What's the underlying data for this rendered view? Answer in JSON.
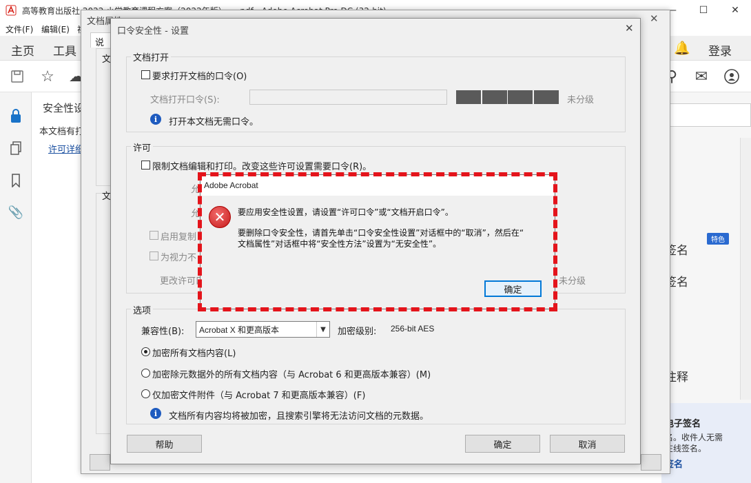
{
  "app": {
    "title": "高等教育出版社 2022 小学教育课程方案（2022年版）… .pdf - Adobe Acrobat Pro DC (32-bit)",
    "win_minimize": "—",
    "win_maximize": "☐",
    "win_close": "✕"
  },
  "menubar": [
    "文件(F)",
    "编辑(E)",
    "视"
  ],
  "navbar": {
    "home": "主页",
    "tools": "工具",
    "login": "登录"
  },
  "left_panel": {
    "title": "安全性设",
    "desc": "本文档有打",
    "link": "许可详细"
  },
  "right_panel": {
    "items": [
      "签名",
      "签名",
      "注释"
    ],
    "badge": "特色",
    "footer_title": "电子签名",
    "footer_line1": "名。收件人无需",
    "footer_line2": "在线签名。",
    "footer_link": "签名"
  },
  "doc_props": {
    "title": "文档属性",
    "tab": "说明",
    "group1": "文",
    "group2": "文"
  },
  "pw_dialog": {
    "title": "口令安全性 - 设置",
    "open_group": "文档打开",
    "require_open_pw": "要求打开文档的口令(O)",
    "open_pw_label": "文档打开口令(S):",
    "open_pw_value": "",
    "strength": "未分级",
    "open_info": "打开本文档无需口令。",
    "perm_group": "许可",
    "restrict_label": "限制文档编辑和打印。改变这些许可设置需要口令(R)。",
    "allow1": "允",
    "allow2": "允",
    "enable_copy": "启用复制",
    "vision": "为视力不",
    "change_perm": "更改许可口",
    "perm_strength": "未分级",
    "options_group": "选项",
    "compat_label": "兼容性(B):",
    "compat_value": "Acrobat X 和更高版本",
    "enc_level_label": "加密级别:",
    "enc_level_value": "256-bit AES",
    "radio1": "加密所有文档内容(L)",
    "radio2": "加密除元数据外的所有文档内容（与 Acrobat 6 和更高版本兼容）(M)",
    "radio3": "仅加密文件附件（与 Acrobat 7 和更高版本兼容）(F)",
    "options_info": "文档所有内容均将被加密，且搜索引擎将无法访问文档的元数据。",
    "help_btn": "帮助",
    "ok_btn": "确定",
    "cancel_btn": "取消"
  },
  "alert": {
    "title": "Adobe Acrobat",
    "line1": "要应用安全性设置，请设置“许可口令”或“文档开启口令”。",
    "line2": "要删除口令安全性，请首先单击“口令安全性设置”对话框中的“取消”，然后在“",
    "line3": "文档属性”对话框中将“安全性方法”设置为“无安全性”。",
    "ok_btn": "确定"
  },
  "colors": {
    "alert_dash": "#e4141b",
    "error_icon": "#c61b1b",
    "info_icon": "#1e5bbf"
  }
}
